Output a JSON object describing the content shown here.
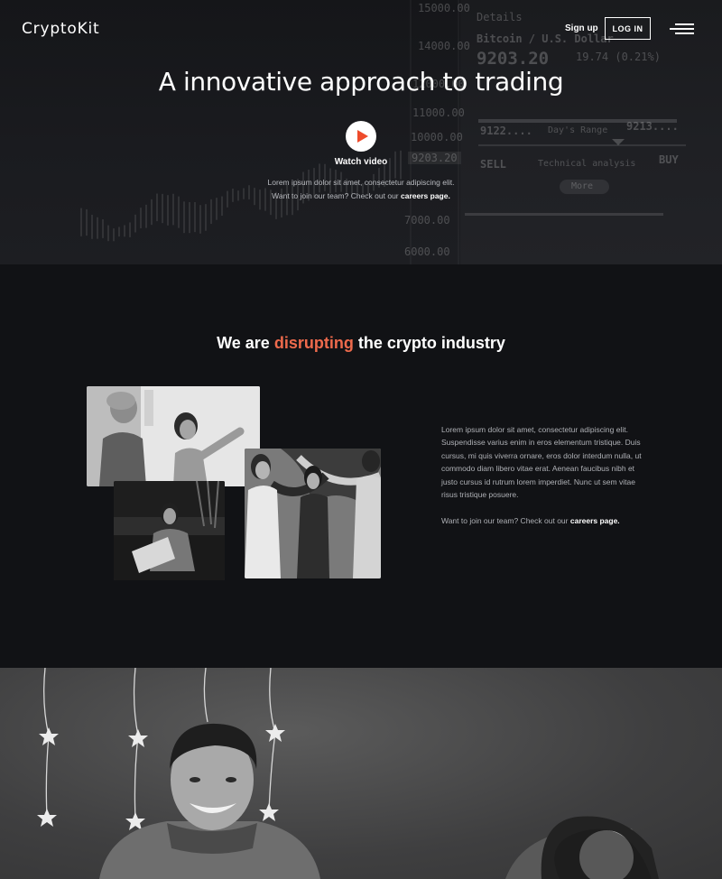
{
  "header": {
    "brand": "CryptoKit",
    "signup_label": "Sign up",
    "login_label": "LOG IN",
    "menu_icon": "hamburger-menu-icon"
  },
  "hero": {
    "title": "A innovative approach to trading",
    "watch_label": "Watch video",
    "desc_line1": "Lorem ipsum dolor sit amet, consectetur adipiscing elit.",
    "desc_line2_prefix": "Want to join our team? Check out our",
    "desc_link": "careers page.",
    "play_color": "#ee4b2b",
    "ticker": {
      "values": [
        "15000.00",
        "14000.00",
        "12000.00",
        "11000.00",
        "10000.00",
        "7000.00",
        "6000.00",
        "9203.20"
      ],
      "details": "Details",
      "pair": "Bitcoin / U.S. Dollar",
      "price": "9203.20",
      "change": "19.74 (0.21%)",
      "bid": "9122....",
      "range_label": "Day's Range",
      "ask": "9213....",
      "sell": "SELL",
      "tech": "Technical analysis",
      "buy": "BUY",
      "more": "More"
    }
  },
  "about": {
    "title_prefix": "We are",
    "title_accent": "disrupting",
    "title_suffix": "the crypto industry",
    "accent_color": "#ee6a4c",
    "paragraph": "Lorem ipsum dolor sit amet, consectetur adipiscing elit. Suspendisse varius enim in eros elementum tristique. Duis cursus, mi quis viverra ornare, eros dolor interdum nulla, ut commodo diam libero vitae erat. Aenean faucibus nibh et justo cursus id rutrum lorem imperdiet. Nunc ut sem vitae risus tristique posuere.",
    "careers_prefix": "Want to join our team? Check out our",
    "careers_link": "careers page."
  }
}
